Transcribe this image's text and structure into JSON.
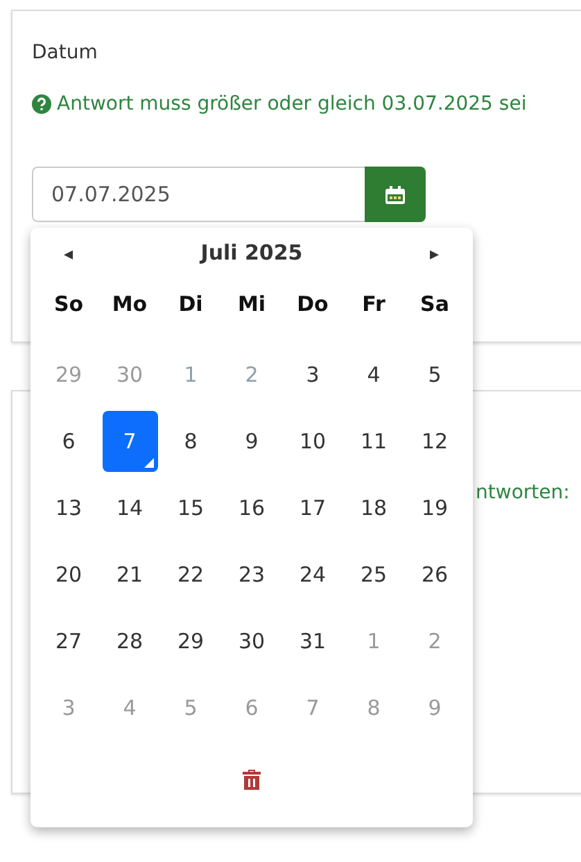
{
  "field": {
    "label": "Datum",
    "hint": "Antwort muss größer oder gleich 03.07.2025 sei",
    "value": "07.07.2025"
  },
  "second_card": {
    "text": "ntworten:"
  },
  "calendar": {
    "prev": "◂",
    "title": "Juli 2025",
    "next": "▸",
    "weekdays": [
      "So",
      "Mo",
      "Di",
      "Mi",
      "Do",
      "Fr",
      "Sa"
    ],
    "weeks": [
      [
        {
          "label": "29",
          "selected": false,
          "other_month": true,
          "disabled": false
        },
        {
          "label": "30",
          "selected": false,
          "other_month": true,
          "disabled": false
        },
        {
          "label": "1",
          "selected": false,
          "other_month": false,
          "disabled": true
        },
        {
          "label": "2",
          "selected": false,
          "other_month": false,
          "disabled": true
        },
        {
          "label": "3",
          "selected": false,
          "other_month": false,
          "disabled": false
        },
        {
          "label": "4",
          "selected": false,
          "other_month": false,
          "disabled": false
        },
        {
          "label": "5",
          "selected": false,
          "other_month": false,
          "disabled": false
        }
      ],
      [
        {
          "label": "6",
          "selected": false,
          "other_month": false,
          "disabled": false
        },
        {
          "label": "7",
          "selected": true,
          "other_month": false,
          "disabled": false
        },
        {
          "label": "8",
          "selected": false,
          "other_month": false,
          "disabled": false
        },
        {
          "label": "9",
          "selected": false,
          "other_month": false,
          "disabled": false
        },
        {
          "label": "10",
          "selected": false,
          "other_month": false,
          "disabled": false
        },
        {
          "label": "11",
          "selected": false,
          "other_month": false,
          "disabled": false
        },
        {
          "label": "12",
          "selected": false,
          "other_month": false,
          "disabled": false
        }
      ],
      [
        {
          "label": "13",
          "selected": false,
          "other_month": false,
          "disabled": false
        },
        {
          "label": "14",
          "selected": false,
          "other_month": false,
          "disabled": false
        },
        {
          "label": "15",
          "selected": false,
          "other_month": false,
          "disabled": false
        },
        {
          "label": "16",
          "selected": false,
          "other_month": false,
          "disabled": false
        },
        {
          "label": "17",
          "selected": false,
          "other_month": false,
          "disabled": false
        },
        {
          "label": "18",
          "selected": false,
          "other_month": false,
          "disabled": false
        },
        {
          "label": "19",
          "selected": false,
          "other_month": false,
          "disabled": false
        }
      ],
      [
        {
          "label": "20",
          "selected": false,
          "other_month": false,
          "disabled": false
        },
        {
          "label": "21",
          "selected": false,
          "other_month": false,
          "disabled": false
        },
        {
          "label": "22",
          "selected": false,
          "other_month": false,
          "disabled": false
        },
        {
          "label": "23",
          "selected": false,
          "other_month": false,
          "disabled": false
        },
        {
          "label": "24",
          "selected": false,
          "other_month": false,
          "disabled": false
        },
        {
          "label": "25",
          "selected": false,
          "other_month": false,
          "disabled": false
        },
        {
          "label": "26",
          "selected": false,
          "other_month": false,
          "disabled": false
        }
      ],
      [
        {
          "label": "27",
          "selected": false,
          "other_month": false,
          "disabled": false
        },
        {
          "label": "28",
          "selected": false,
          "other_month": false,
          "disabled": false
        },
        {
          "label": "29",
          "selected": false,
          "other_month": false,
          "disabled": false
        },
        {
          "label": "30",
          "selected": false,
          "other_month": false,
          "disabled": false
        },
        {
          "label": "31",
          "selected": false,
          "other_month": false,
          "disabled": false
        },
        {
          "label": "1",
          "selected": false,
          "other_month": true,
          "disabled": false
        },
        {
          "label": "2",
          "selected": false,
          "other_month": true,
          "disabled": false
        }
      ],
      [
        {
          "label": "3",
          "selected": false,
          "other_month": true,
          "disabled": false
        },
        {
          "label": "4",
          "selected": false,
          "other_month": true,
          "disabled": false
        },
        {
          "label": "5",
          "selected": false,
          "other_month": true,
          "disabled": false
        },
        {
          "label": "6",
          "selected": false,
          "other_month": true,
          "disabled": false
        },
        {
          "label": "7",
          "selected": false,
          "other_month": true,
          "disabled": false
        },
        {
          "label": "8",
          "selected": false,
          "other_month": true,
          "disabled": false
        },
        {
          "label": "9",
          "selected": false,
          "other_month": true,
          "disabled": false
        }
      ]
    ]
  }
}
